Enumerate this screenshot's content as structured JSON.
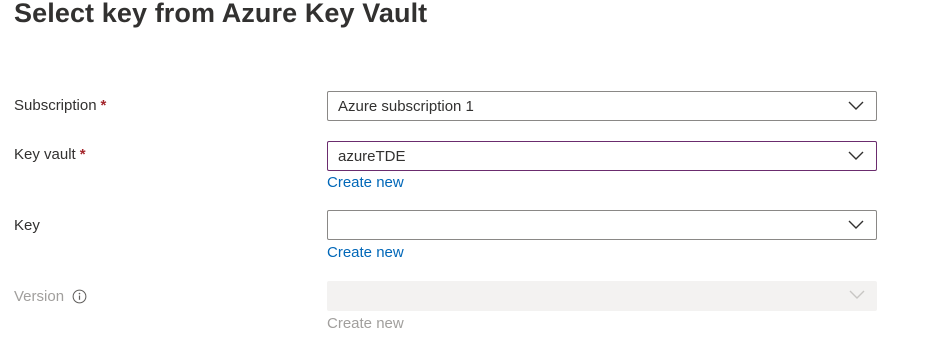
{
  "page": {
    "title": "Select key from Azure Key Vault"
  },
  "form": {
    "subscription": {
      "label": "Subscription",
      "required_mark": "*",
      "value": "Azure subscription 1"
    },
    "key_vault": {
      "label": "Key vault",
      "required_mark": "*",
      "value": "azureTDE",
      "create_new": "Create new"
    },
    "key": {
      "label": "Key",
      "value": "",
      "create_new": "Create new"
    },
    "version": {
      "label": "Version",
      "info_icon": "info-icon",
      "value": "",
      "create_new": "Create new"
    }
  },
  "colors": {
    "required": "#a4262c",
    "link": "#0067b8",
    "focused_border": "#6b2c6e",
    "disabled_text": "#a19f9d",
    "disabled_bg": "#f3f2f1"
  }
}
